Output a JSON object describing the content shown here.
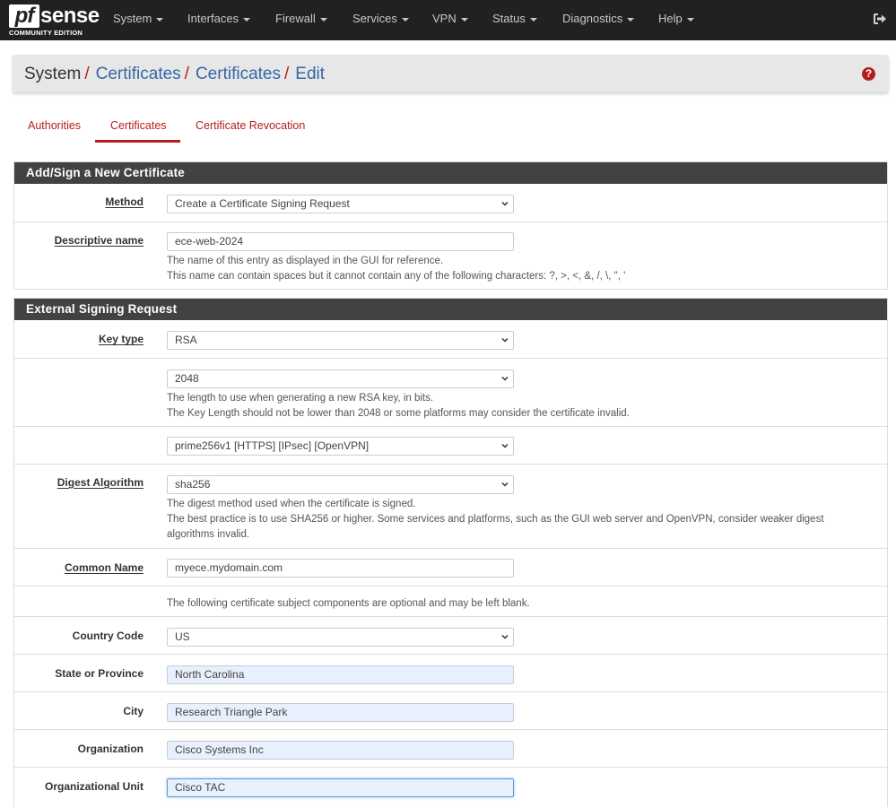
{
  "navbar": {
    "logo_mark": "pf",
    "logo_word": "sense",
    "logo_edition": "COMMUNITY EDITION",
    "items": [
      {
        "label": "System"
      },
      {
        "label": "Interfaces"
      },
      {
        "label": "Firewall"
      },
      {
        "label": "Services"
      },
      {
        "label": "VPN"
      },
      {
        "label": "Status"
      },
      {
        "label": "Diagnostics"
      },
      {
        "label": "Help"
      }
    ],
    "logout_icon": "sign-out-icon"
  },
  "breadcrumb": {
    "root": "System",
    "sep": "/",
    "links": [
      "Certificates",
      "Certificates",
      "Edit"
    ],
    "help_glyph": "?"
  },
  "tabs": [
    {
      "label": "Authorities",
      "active": false
    },
    {
      "label": "Certificates",
      "active": true
    },
    {
      "label": "Certificate Revocation",
      "active": false
    }
  ],
  "section1": {
    "title": "Add/Sign a New Certificate",
    "method_label": "Method",
    "method_value": "Create a Certificate Signing Request",
    "desc_label": "Descriptive name",
    "desc_value": "ece-web-2024",
    "desc_help1": "The name of this entry as displayed in the GUI for reference.",
    "desc_help2": "This name can contain spaces but it cannot contain any of the following characters: ?, >, <, &, /, \\, \", '"
  },
  "section2": {
    "title": "External Signing Request",
    "keytype_label": "Key type",
    "keytype_value": "RSA",
    "keylen_value": "2048",
    "keylen_help1": "The length to use when generating a new RSA key, in bits.",
    "keylen_help2": "The Key Length should not be lower than 2048 or some platforms may consider the certificate invalid.",
    "curve_value": "prime256v1 [HTTPS] [IPsec] [OpenVPN]",
    "digest_label": "Digest Algorithm",
    "digest_value": "sha256",
    "digest_help1": "The digest method used when the certificate is signed.",
    "digest_help2": "The best practice is to use SHA256 or higher. Some services and platforms, such as the GUI web server and OpenVPN, consider weaker digest",
    "digest_help3": "algorithms invalid.",
    "cn_label": "Common Name",
    "cn_value": "myece.mydomain.com",
    "optional_note": "The following certificate subject components are optional and may be left blank.",
    "country_label": "Country Code",
    "country_value": "US",
    "state_label": "State or Province",
    "state_value": "North Carolina",
    "city_label": "City",
    "city_value": "Research Triangle Park",
    "org_label": "Organization",
    "org_value": "Cisco Systems Inc",
    "ou_label": "Organizational Unit",
    "ou_value": "Cisco TAC"
  },
  "colors": {
    "navbar_bg": "#212121",
    "accent_red": "#b71c1c",
    "link_blue": "#3567a4",
    "panel_head": "#424242",
    "autofill": "#e8f0fe"
  }
}
